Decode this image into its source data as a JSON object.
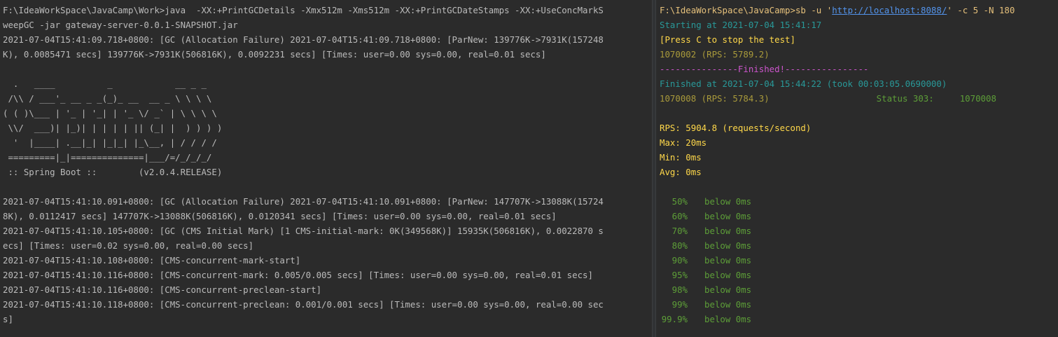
{
  "colors": {
    "background": "#2b2b2b",
    "text": "#bbbbbb",
    "cyan": "#299999",
    "yellow": "#ffd84a",
    "olive": "#a99a3b",
    "magenta": "#cc55cc",
    "green": "#5d9e38",
    "link": "#5394ec"
  },
  "left_terminal": {
    "lines": [
      "F:\\IdeaWorkSpace\\JavaCamp\\Work>java  -XX:+PrintGCDetails -Xmx512m -Xms512m -XX:+PrintGCDateStamps -XX:+UseConcMarkS",
      "weepGC -jar gateway-server-0.0.1-SNAPSHOT.jar",
      "2021-07-04T15:41:09.718+0800: [GC (Allocation Failure) 2021-07-04T15:41:09.718+0800: [ParNew: 139776K->7931K(157248",
      "K), 0.0085471 secs] 139776K->7931K(506816K), 0.0092231 secs] [Times: user=0.00 sys=0.00, real=0.01 secs]",
      "",
      "  .   ____          _            __ _ _",
      " /\\\\ / ___'_ __ _ _(_)_ __  __ _ \\ \\ \\ \\",
      "( ( )\\___ | '_ | '_| | '_ \\/ _` | \\ \\ \\ \\",
      " \\\\/  ___)| |_)| | | | | || (_| |  ) ) ) )",
      "  '  |____| .__|_| |_|_| |_\\__, | / / / /",
      " =========|_|==============|___/=/_/_/_/",
      " :: Spring Boot ::        (v2.0.4.RELEASE)",
      "",
      "2021-07-04T15:41:10.091+0800: [GC (Allocation Failure) 2021-07-04T15:41:10.091+0800: [ParNew: 147707K->13088K(15724",
      "8K), 0.0112417 secs] 147707K->13088K(506816K), 0.0120341 secs] [Times: user=0.00 sys=0.00, real=0.01 secs]",
      "2021-07-04T15:41:10.105+0800: [GC (CMS Initial Mark) [1 CMS-initial-mark: 0K(349568K)] 15935K(506816K), 0.0022870 s",
      "ecs] [Times: user=0.02 sys=0.00, real=0.00 secs]",
      "2021-07-04T15:41:10.108+0800: [CMS-concurrent-mark-start]",
      "2021-07-04T15:41:10.116+0800: [CMS-concurrent-mark: 0.005/0.005 secs] [Times: user=0.00 sys=0.00, real=0.01 secs]",
      "2021-07-04T15:41:10.116+0800: [CMS-concurrent-preclean-start]",
      "2021-07-04T15:41:10.118+0800: [CMS-concurrent-preclean: 0.001/0.001 secs] [Times: user=0.00 sys=0.00, real=0.00 sec",
      "s]"
    ]
  },
  "right_terminal": {
    "command_prefix": "F:\\IdeaWorkSpace\\JavaCamp>sb -u '",
    "command_url": "http://localhost:8088/",
    "command_suffix": "' -c 5 -N 180",
    "starting": "Starting at 2021-07-04 15:41:17",
    "press_c": "[Press C to stop the test]",
    "progress": "1070002 (RPS: 5789.2)",
    "finished_banner": "---------------Finished!----------------",
    "finished_at": "Finished at 2021-07-04 15:44:22 (took 00:03:05.0690000)",
    "final_count": "1070008 (RPS: 5784.3)",
    "status_label": "Status 303:",
    "status_value": "1070008",
    "rps": "RPS: 5904.8 (requests/second)",
    "max": "Max: 20ms",
    "min": "Min: 0ms",
    "avg": "Avg: 0ms",
    "percentiles": [
      {
        "pct": "50%",
        "text": "below 0ms"
      },
      {
        "pct": "60%",
        "text": "below 0ms"
      },
      {
        "pct": "70%",
        "text": "below 0ms"
      },
      {
        "pct": "80%",
        "text": "below 0ms"
      },
      {
        "pct": "90%",
        "text": "below 0ms"
      },
      {
        "pct": "95%",
        "text": "below 0ms"
      },
      {
        "pct": "98%",
        "text": "below 0ms"
      },
      {
        "pct": "99%",
        "text": "below 0ms"
      },
      {
        "pct": "99.9%",
        "text": "below 0ms"
      }
    ]
  }
}
